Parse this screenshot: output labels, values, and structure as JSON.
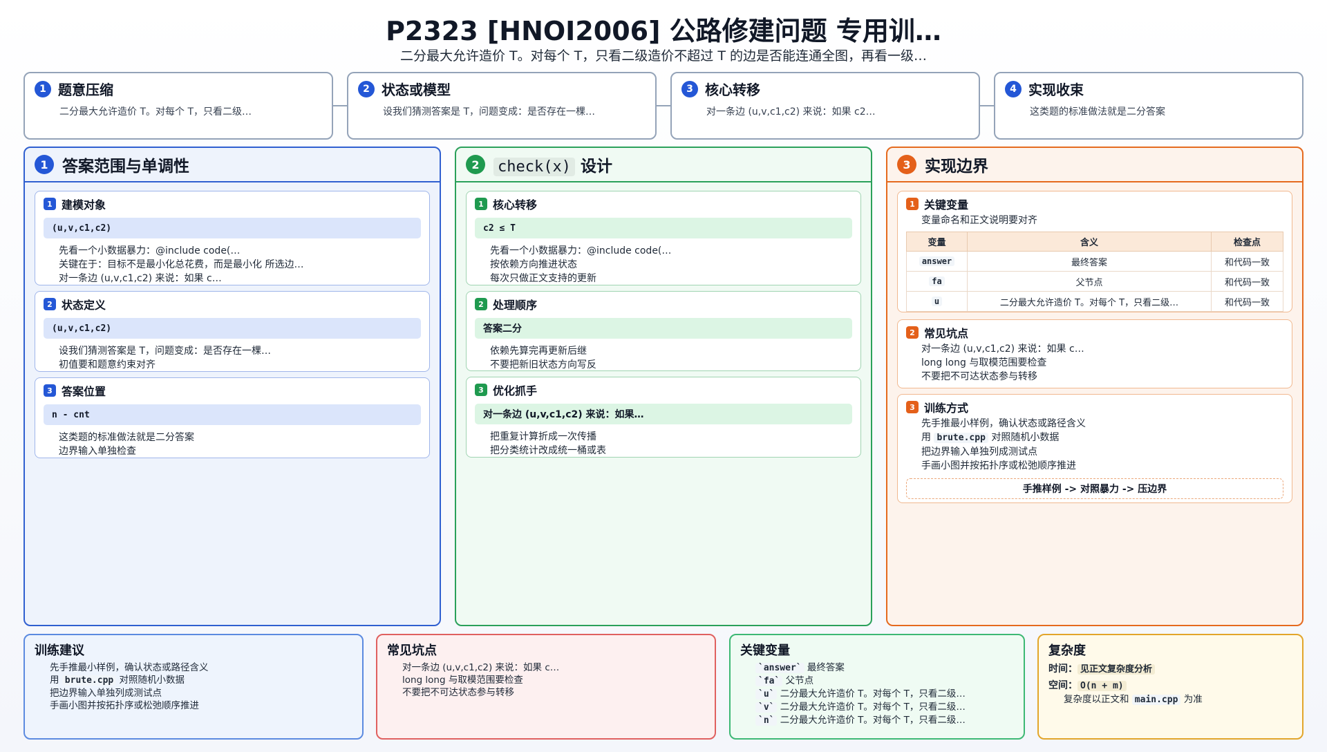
{
  "header": {
    "title": "P2323 [HNOI2006] 公路修建问题 专用训…",
    "subtitle": "二分最大允许造价 T。对每个 T，只看二级造价不超过 T 的边是否能连通全图，再看一级…"
  },
  "steps": [
    {
      "num": "1",
      "title": "题意压缩",
      "desc": "二分最大允许造价 T。对每个 T，只看二级…"
    },
    {
      "num": "2",
      "title": "状态或模型",
      "desc": "设我们猜测答案是 T，问题变成：是否存在一棵…"
    },
    {
      "num": "3",
      "title": "核心转移",
      "desc": "对一条边 (u,v,c1,c2) 来说：如果 c2…"
    },
    {
      "num": "4",
      "title": "实现收束",
      "desc": "这类题的标准做法就是二分答案"
    }
  ],
  "columns": {
    "answer": {
      "num": "1",
      "title": "答案范围与单调性",
      "cards": [
        {
          "num": "1",
          "title": "建模对象",
          "pill": "(u,v,c1,c2)",
          "bullets": [
            "先看一个小数据暴力：@include code(…",
            "关键在于：目标不是最小化总花费，而是最小化 所选边…",
            "对一条边 (u,v,c1,c2) 来说：如果 c…"
          ]
        },
        {
          "num": "2",
          "title": "状态定义",
          "pill": "(u,v,c1,c2)",
          "bullets": [
            "设我们猜测答案是 T，问题变成：是否存在一棵…",
            "初值要和题意约束对齐"
          ]
        },
        {
          "num": "3",
          "title": "答案位置",
          "pill": "n - cnt",
          "bullets": [
            "这类题的标准做法就是二分答案",
            "边界输入单独检查"
          ]
        }
      ]
    },
    "check": {
      "num": "2",
      "title_code": "check(x)",
      "title_rest": "设计",
      "cards": [
        {
          "num": "1",
          "title": "核心转移",
          "pill": "c2 ≤ T",
          "bullets": [
            "先看一个小数据暴力：@include code(…",
            "按依赖方向推进状态",
            "每次只做正文支持的更新"
          ]
        },
        {
          "num": "2",
          "title": "处理顺序",
          "pill": "答案二分",
          "bullets": [
            "依赖先算完再更新后继",
            "不要把新旧状态方向写反"
          ]
        },
        {
          "num": "3",
          "title": "优化抓手",
          "pill": "对一条边 (u,v,c1,c2) 来说：如果…",
          "bullets": [
            "把重复计算折成一次传播",
            "把分类统计改成统一桶或表"
          ]
        }
      ]
    },
    "impl": {
      "num": "3",
      "title": "实现边界",
      "vars_card": {
        "num": "1",
        "title": "关键变量",
        "bullet": "变量命名和正文说明要对齐",
        "headers": [
          "变量",
          "含义",
          "检查点"
        ],
        "rows": [
          [
            "answer",
            "最终答案",
            "和代码一致"
          ],
          [
            "fa",
            "父节点",
            "和代码一致"
          ],
          [
            "u",
            "二分最大允许造价 T。对每个 T，只看二级…",
            "和代码一致"
          ]
        ]
      },
      "pitfalls_card": {
        "num": "2",
        "title": "常见坑点",
        "bullets": [
          "对一条边 (u,v,c1,c2) 来说：如果 c…",
          "long long 与取模范围要检查",
          "不要把不可达状态参与转移"
        ]
      },
      "train_card": {
        "num": "3",
        "title": "训练方式",
        "b1": "先手推最小样例，确认状态或路径含义",
        "b2_pre": "用",
        "b2_code": "brute.cpp",
        "b2_post": "对照随机小数据",
        "b3": "把边界输入单独列成测试点",
        "b4": "手画小图并按拓扑序或松弛顺序推进",
        "flow": "手推样例 -> 对照暴力 -> 压边界"
      }
    }
  },
  "bottom": {
    "training": {
      "title": "训练建议",
      "b1": "先手推最小样例，确认状态或路径含义",
      "b2_pre": "用",
      "b2_code": "brute.cpp",
      "b2_post": "对照随机小数据",
      "b3": "把边界输入单独列成测试点",
      "b4": "手画小图并按拓扑序或松弛顺序推进"
    },
    "pitfalls": {
      "title": "常见坑点",
      "bullets": [
        "对一条边 (u,v,c1,c2) 来说：如果 c…",
        "long long 与取模范围要检查",
        "不要把不可达状态参与转移"
      ]
    },
    "keyvars": {
      "title": "关键变量",
      "items": [
        {
          "code": "`answer`",
          "text": "最终答案"
        },
        {
          "code": "`fa`",
          "text": "父节点"
        },
        {
          "code": "`u`",
          "text": "二分最大允许造价 T。对每个 T，只看二级…"
        },
        {
          "code": "`v`",
          "text": "二分最大允许造价 T。对每个 T，只看二级…"
        },
        {
          "code": "`n`",
          "text": "二分最大允许造价 T。对每个 T，只看二级…"
        }
      ]
    },
    "complexity": {
      "title": "复杂度",
      "time_label": "时间：",
      "time_value": "见正文复杂度分析",
      "space_label": "空间：",
      "space_value": "O(n + m)",
      "note_pre": "复杂度以正文和",
      "note_code": "main.cpp",
      "note_post": "为准"
    }
  },
  "colors": {
    "blue": "#2457d6",
    "green": "#1f9a4f",
    "orange": "#e4601a",
    "red": "#e0605f",
    "yellow": "#e2a52a"
  }
}
